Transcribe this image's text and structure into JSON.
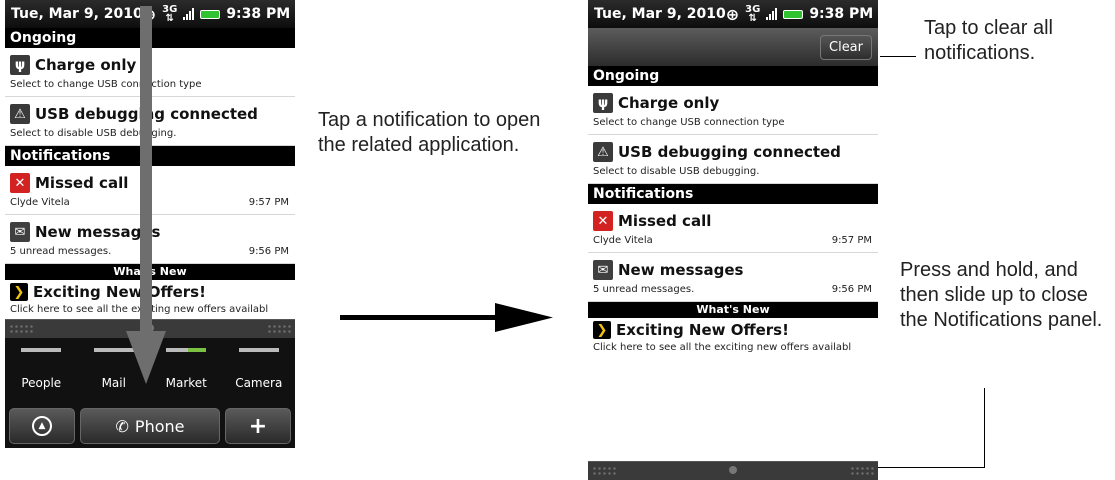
{
  "status_bar": {
    "date": "Tue, Mar 9, 2010",
    "network": "3G",
    "time": "9:38 PM"
  },
  "clear_button": "Clear",
  "sections": {
    "ongoing": "Ongoing",
    "notifications": "Notifications",
    "whats_new": "What's New"
  },
  "ongoing": [
    {
      "icon": "usb-icon",
      "title": "Charge only",
      "subtitle": "Select to change USB connection type"
    },
    {
      "icon": "warning-icon",
      "title": "USB debugging connected",
      "subtitle": "Select to disable USB debugging."
    }
  ],
  "notifications": [
    {
      "icon": "missed-call-icon",
      "title": "Missed call",
      "subtitle": "Clyde Vitela",
      "time": "9:57 PM"
    },
    {
      "icon": "message-icon",
      "title": "New messages",
      "subtitle": "5 unread messages.",
      "time": "9:56 PM"
    }
  ],
  "offer": {
    "icon": "sprint-icon",
    "title": "Exciting New Offers!",
    "subtitle": "Click here to see all the exciting new offers availabl"
  },
  "launcher": {
    "apps": [
      "People",
      "Mail",
      "Market",
      "Camera"
    ],
    "phone_label": "Phone"
  },
  "captions": {
    "tap_notification": "Tap a notification to open the related application.",
    "tap_clear": "Tap to clear all notifications.",
    "press_hold": "Press and hold, and then slide up to close the Notifications panel."
  },
  "colors": {
    "missed_call": "#d22222",
    "drag_arrow": "#6e6e6e",
    "battery": "#31c231"
  }
}
